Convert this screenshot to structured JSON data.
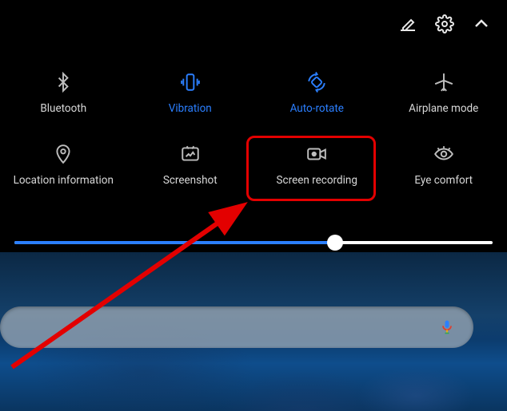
{
  "topbar": {
    "icons": [
      "edit-icon",
      "settings-icon",
      "collapse-icon"
    ]
  },
  "tiles": [
    {
      "id": "bluetooth",
      "label": "Bluetooth",
      "active": false
    },
    {
      "id": "vibration",
      "label": "Vibration",
      "active": true
    },
    {
      "id": "autorotate",
      "label": "Auto-rotate",
      "active": true
    },
    {
      "id": "airplane",
      "label": "Airplane mode",
      "active": false
    },
    {
      "id": "location",
      "label": "Location information",
      "active": false
    },
    {
      "id": "screenshot",
      "label": "Screenshot",
      "active": false
    },
    {
      "id": "screenrec",
      "label": "Screen recording",
      "active": false
    },
    {
      "id": "eyecomfort",
      "label": "Eye comfort",
      "active": false
    }
  ],
  "brightness": {
    "percent": 67
  },
  "annotation": {
    "highlighted_tile": "screenrec",
    "arrow_color": "#e30000"
  }
}
